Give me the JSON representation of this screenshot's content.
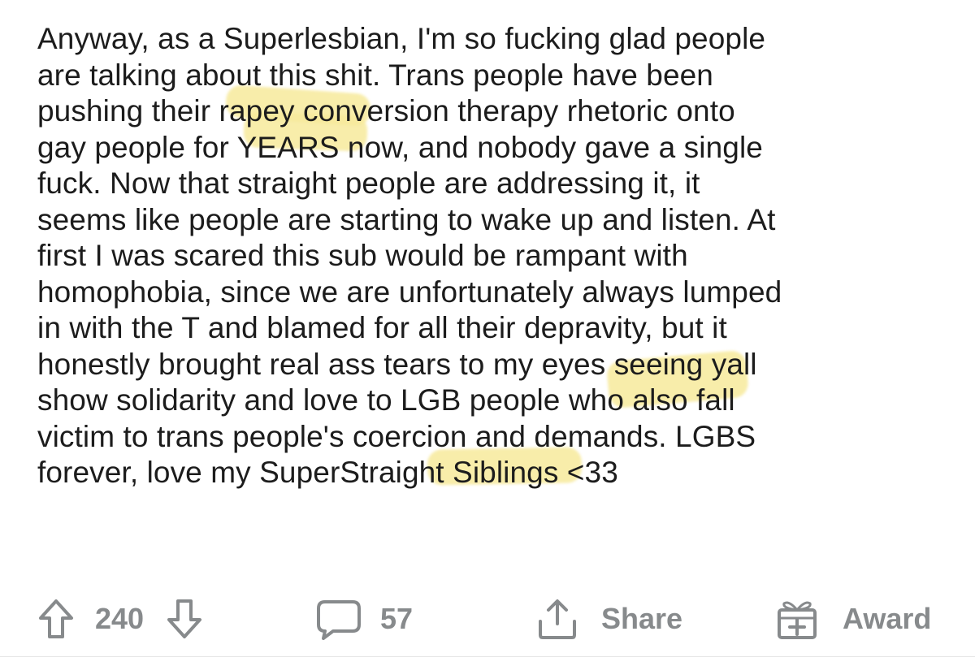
{
  "comment": {
    "lines": [
      "Anyway, as a Superlesbian, I'm so fucking glad people",
      "are talking about this shit. Trans people have been",
      "pushing their rapey conversion therapy rhetoric onto",
      "gay people for YEARS now, and nobody gave a single",
      "fuck. Now that straight people are addressing it, it",
      "seems like people are starting to wake up and listen. At",
      "first I was scared this sub would be rampant with",
      "homophobia, since we are unfortunately always lumped",
      "in with the T and blamed for all their depravity, but it",
      "honestly brought real ass tears to my eyes seeing yall",
      "show solidarity and love to LGB people who also fall",
      "victim to trans people's coercion and demands. LGBS",
      "forever, love my SuperStraight Siblings <33"
    ]
  },
  "actions": {
    "upvote_icon": "arrow-up-icon",
    "vote_count": "240",
    "downvote_icon": "arrow-down-icon",
    "comment_icon": "comment-bubble-icon",
    "comment_count": "57",
    "share_icon": "share-icon",
    "share_label": "Share",
    "award_icon": "gift-icon",
    "award_label": "Award"
  },
  "colors": {
    "text": "#1c1c1c",
    "action_gray": "#878a8c",
    "highlight": "#f7ea9c"
  }
}
